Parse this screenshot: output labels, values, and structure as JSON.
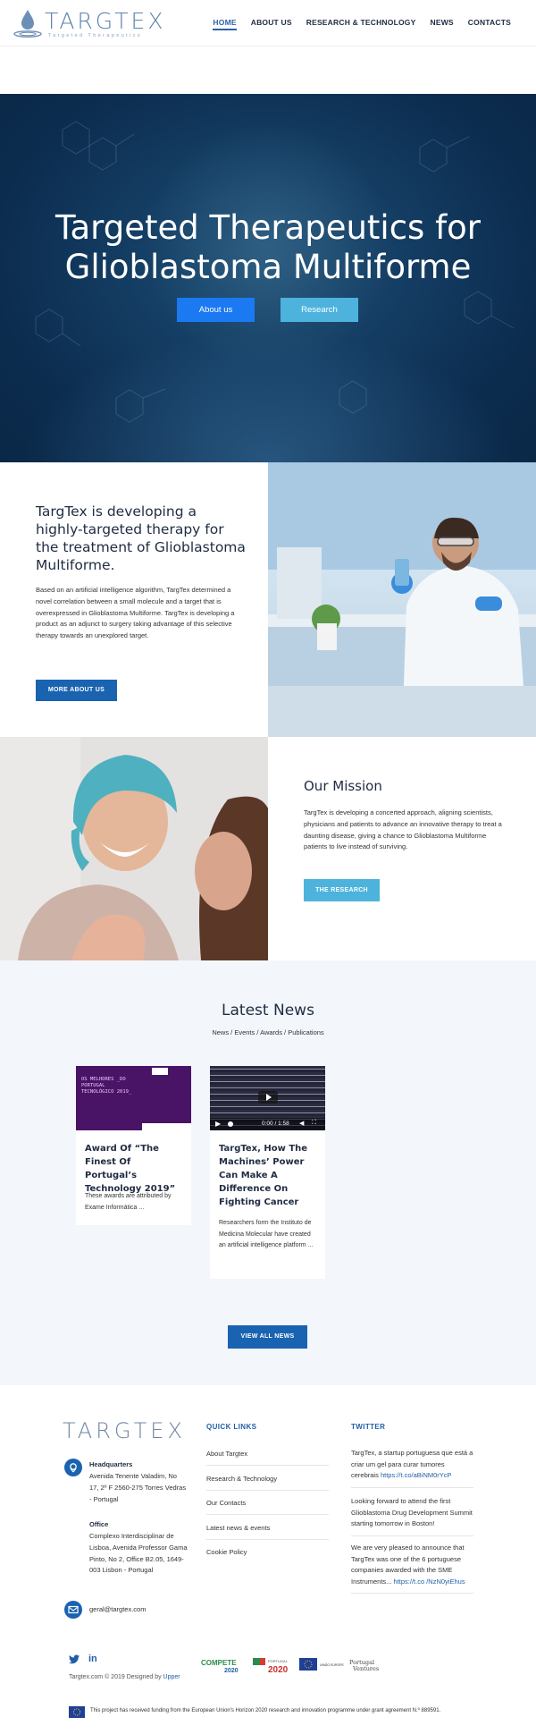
{
  "header": {
    "logo_text": "TARGTEX",
    "logo_tagline": "Targeted Therapeutics",
    "nav": [
      {
        "label": "HOME",
        "active": true
      },
      {
        "label": "ABOUT US"
      },
      {
        "label": "RESEARCH & TECHNOLOGY"
      },
      {
        "label": "NEWS"
      },
      {
        "label": "CONTACTS"
      }
    ]
  },
  "hero": {
    "title_line1": "Targeted Therapeutics for",
    "title_line2": "Glioblastoma Multiforme",
    "btn_about": "About us",
    "btn_research": "Research"
  },
  "intro": {
    "title": "TargTex is developing a highly-targeted therapy for the treatment of Glioblastoma Multiforme.",
    "body": "Based on an artificial intelligence algorithm, TargTex determined a novel correlation between a small molecule and a target that is overexpressed in Glioblastoma Multiforme. TargTex is developing a product as an adjunct to surgery taking advantage of this selective therapy towards an unexplored target.",
    "button": "MORE ABOUT US"
  },
  "mission": {
    "title": "Our Mission",
    "body": "TargTex is developing a concerted approach, aligning scientists, physicians and patients to advance an innovative therapy to treat a daunting disease, giving a chance to Glioblastoma Multiforme patients to live instead of surviving.",
    "button": "THE RESEARCH"
  },
  "news": {
    "title": "Latest News",
    "subtitle": "News / Events / Awards / Publications",
    "cards": [
      {
        "thumb_text": "OS MELHORES _DO PORTUGAL TECNOLÓGICO 2019_",
        "title": "Award Of “The Finest Of Portugal’s Technology 2019”",
        "excerpt": "These awards are attributed by Exame Informática ..."
      },
      {
        "video_time": "0:00 / 1:58",
        "title": "TargTex, How The Machines’ Power Can Make A Difference On Fighting Cancer",
        "excerpt": "Researchers form the Instituto de Medicina Molecular have created an artificial intelligence platform ..."
      }
    ],
    "button": "VIEW ALL NEWS"
  },
  "footer": {
    "logo_text": "TARGTEX",
    "hq_label": "Headquarters",
    "hq_address": "Avenida Tenente Valadim, No 17, 2º F 2560-275 Torres Vedras - Portugal",
    "office_label": "Office",
    "office_address": "Complexo Interdisciplinar de Lisboa, Avenida Professor Gama Pinto, No 2, Office B2.05, 1649-003 Lisbon - Portugal",
    "email": "geral@targtex.com",
    "quick_links_title": "QUICK LINKS",
    "quick_links": [
      "About Targtex",
      "Research & Technology",
      "Our Contacts",
      "Latest news & events",
      "Cookie Policy"
    ],
    "twitter_title": "TWITTER",
    "tweets": [
      {
        "text": "TargTex, a startup portuguesa que está a criar um gel para curar tumores cerebrais ",
        "link": "https://t.co/aBiNM0rYcP"
      },
      {
        "text": "Looking forward to attend the first Glioblastoma Drug Development Summit starting tomorrow in Boston!",
        "link": ""
      },
      {
        "text": "We are very pleased to announce that TargTex was one of the 6 portuguese companies awarded with the SME Instruments... ",
        "link": "https://t.co /NzN0yiEhus"
      }
    ],
    "copyright_prefix": "Targtex.com © 2019 Designed by ",
    "copyright_link": "Upper",
    "partners": [
      "COMPETE 2020",
      "PORTUGAL 2020",
      "UNIÃO EUROPEIA",
      "Portugal Ventures"
    ],
    "funding_text": "This project has received funding from the European Union's Horizon 2020 research and innovation programme under grant agreement N.º 889591."
  }
}
